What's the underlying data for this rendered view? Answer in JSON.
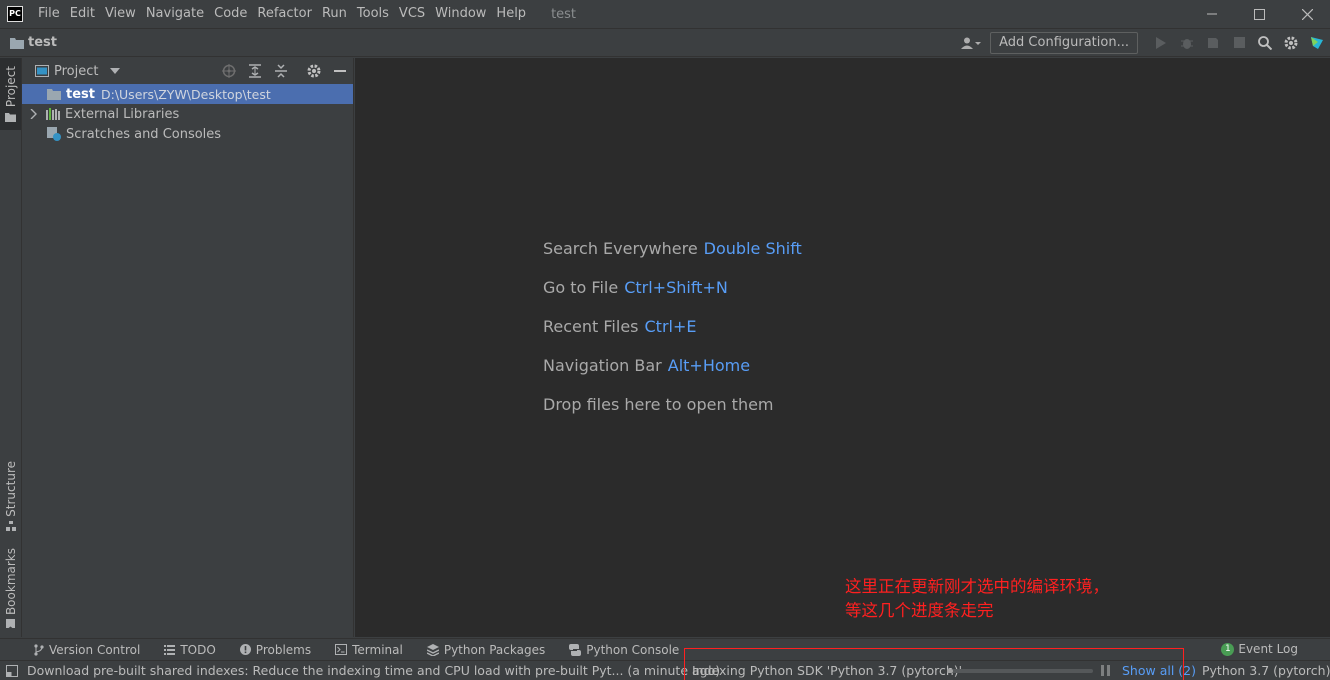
{
  "app": {
    "logo_text": "PC",
    "window_title": "test"
  },
  "menu": [
    "File",
    "Edit",
    "View",
    "Navigate",
    "Code",
    "Refactor",
    "Run",
    "Tools",
    "VCS",
    "Window",
    "Help"
  ],
  "navbar": {
    "project_name": "test",
    "add_configuration": "Add Configuration..."
  },
  "left_tabs": {
    "project": "Project",
    "structure": "Structure",
    "bookmarks": "Bookmarks"
  },
  "project_panel": {
    "title": "Project",
    "tree": {
      "root_name": "test",
      "root_path": "D:\\Users\\ZYW\\Desktop\\test",
      "external_libraries": "External Libraries",
      "scratches": "Scratches and Consoles"
    }
  },
  "editor_hints": [
    {
      "label": "Search Everywhere",
      "key": "Double Shift"
    },
    {
      "label": "Go to File",
      "key": "Ctrl+Shift+N"
    },
    {
      "label": "Recent Files",
      "key": "Ctrl+E"
    },
    {
      "label": "Navigation Bar",
      "key": "Alt+Home"
    },
    {
      "label": "Drop files here to open them",
      "key": ""
    }
  ],
  "annotation": {
    "line1": "这里正在更新刚才选中的编译环境，",
    "line2": "等这几个进度条走完",
    "color": "#ff2020"
  },
  "bottom_tools": {
    "version_control": "Version Control",
    "todo": "TODO",
    "problems": "Problems",
    "terminal": "Terminal",
    "python_packages": "Python Packages",
    "python_console": "Python Console",
    "event_log": "Event Log",
    "event_count": "1"
  },
  "status": {
    "message": "Download pre-built shared indexes: Reduce the indexing time and CPU load with pre-built Pyt... (a minute ago)",
    "indexing": "Indexing Python SDK 'Python 3.7 (pytorch)'",
    "progress": 0.04,
    "show_all": "Show all (2)",
    "interpreter": "Python 3.7 (pytorch)"
  },
  "colors": {
    "accent": "#589df6",
    "selection": "#4b6eaf",
    "editor_bg": "#2b2b2b",
    "panel_bg": "#3c3f41"
  }
}
